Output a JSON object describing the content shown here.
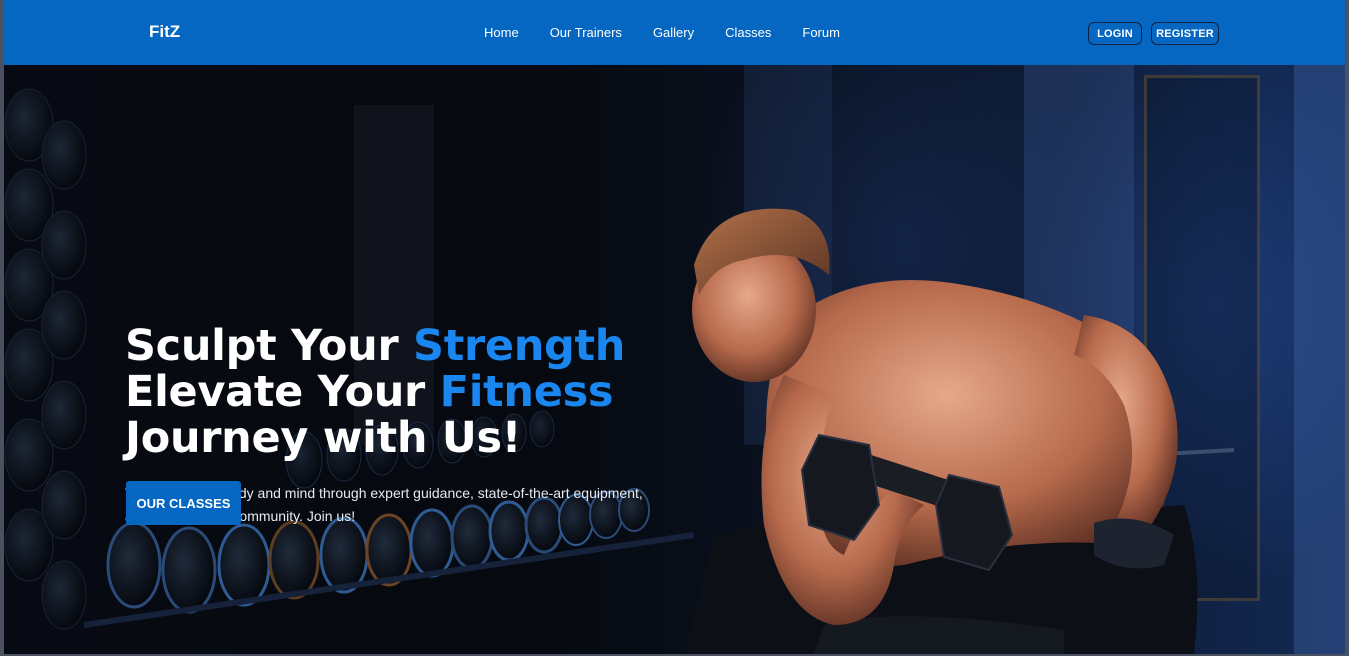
{
  "navbar": {
    "brand": "FitZ",
    "links": [
      "Home",
      "Our Trainers",
      "Gallery",
      "Classes",
      "Forum"
    ],
    "login_label": "LOGIN",
    "register_label": "REGISTER"
  },
  "hero": {
    "line1_prefix": "Sculpt Your ",
    "line1_accent": "Strength",
    "line2_prefix": "Elevate Your ",
    "line2_accent": "Fitness",
    "line3": "Journey with Us!",
    "subtitle": "Transform your body and mind through expert guidance, state-of-the-art equipment, and a supportive community. Join us!",
    "cta_label": "OUR CLASSES"
  },
  "colors": {
    "brand_blue": "#0567c2",
    "accent_blue": "#1a86ef",
    "background_dark": "#05070d"
  }
}
